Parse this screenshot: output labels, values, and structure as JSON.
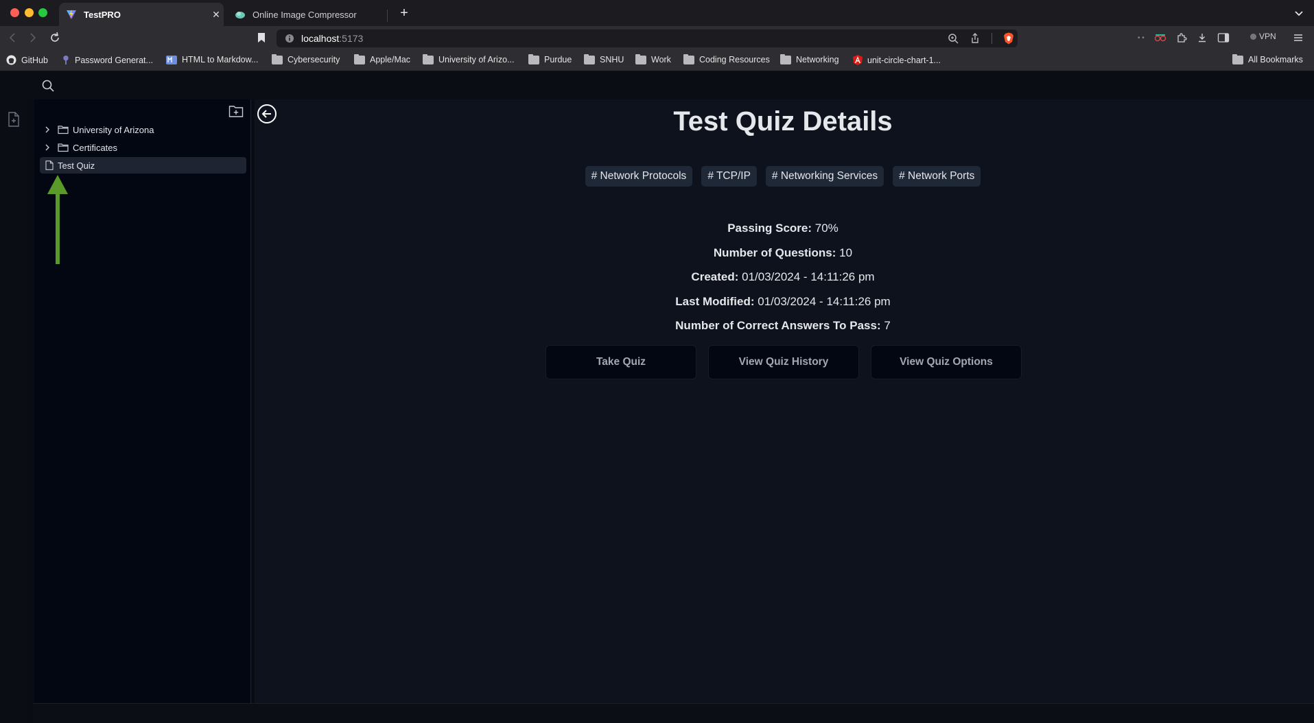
{
  "browser": {
    "tabs": [
      {
        "label": "TestPRO",
        "active": true
      },
      {
        "label": "Online Image Compressor",
        "active": false
      }
    ],
    "url_host": "localhost",
    "url_port": ":5173",
    "vpn_label": "VPN",
    "bookmarks": [
      {
        "label": "GitHub",
        "icon": "github-icon"
      },
      {
        "label": "Password Generat...",
        "icon": "key-icon"
      },
      {
        "label": "HTML to Markdow...",
        "icon": "markdown-icon"
      },
      {
        "label": "Cybersecurity",
        "icon": "folder-icon"
      },
      {
        "label": "Apple/Mac",
        "icon": "folder-icon"
      },
      {
        "label": "University of Arizo...",
        "icon": "folder-icon"
      },
      {
        "label": "Purdue",
        "icon": "folder-icon"
      },
      {
        "label": "SNHU",
        "icon": "folder-icon"
      },
      {
        "label": "Work",
        "icon": "folder-icon"
      },
      {
        "label": "Coding Resources",
        "icon": "folder-icon"
      },
      {
        "label": "Networking",
        "icon": "folder-icon"
      },
      {
        "label": "unit-circle-chart-1...",
        "icon": "angular-icon"
      },
      {
        "label": "All Bookmarks",
        "icon": "folder-icon"
      }
    ]
  },
  "sidebar": {
    "items": [
      {
        "label": "University of Arizona",
        "type": "folder"
      },
      {
        "label": "Certificates",
        "type": "folder"
      },
      {
        "label": "Test Quiz",
        "type": "file",
        "selected": true
      }
    ]
  },
  "quiz": {
    "title": "Test Quiz Details",
    "tags": [
      "# Network Protocols",
      "# TCP/IP",
      "# Networking Services",
      "# Network Ports"
    ],
    "details": [
      {
        "label": "Passing Score:",
        "value": "70%"
      },
      {
        "label": "Number of Questions:",
        "value": "10"
      },
      {
        "label": "Created:",
        "value": "01/03/2024 - 14:11:26 pm"
      },
      {
        "label": "Last Modified:",
        "value": "01/03/2024 - 14:11:26 pm"
      },
      {
        "label": "Number of Correct Answers To Pass:",
        "value": "7"
      }
    ],
    "actions": [
      "Take Quiz",
      "View Quiz History",
      "View Quiz Options"
    ]
  },
  "colors": {
    "arrow": "#5a9a2a",
    "selected_item_bg": "#1e2431",
    "tag_bg": "#1f2837",
    "main_bg": "#0d121d"
  }
}
